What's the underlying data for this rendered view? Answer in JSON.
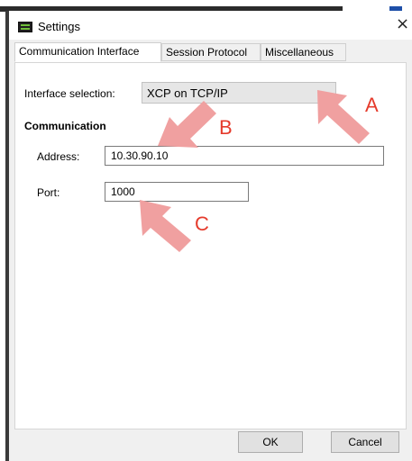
{
  "window": {
    "title": "Settings",
    "close_glyph": "×"
  },
  "tabs": [
    {
      "label": "Communication Interface",
      "active": true
    },
    {
      "label": "Session Protocol",
      "active": false
    },
    {
      "label": "Miscellaneous",
      "active": false
    }
  ],
  "interface": {
    "label": "Interface selection:",
    "value": "XCP on TCP/IP",
    "chevron": "⌄"
  },
  "communication": {
    "heading": "Communication",
    "address_label": "Address:",
    "address_value": "10.30.90.10",
    "port_label": "Port:",
    "port_value": "1000"
  },
  "buttons": {
    "ok": "OK",
    "cancel": "Cancel"
  },
  "annotations": {
    "letters": [
      "A",
      "B",
      "C"
    ],
    "arrow_color": "#f0a0a0",
    "letter_color": "#e53b2c"
  },
  "icons": {
    "app": "settings-app-icon",
    "close": "close-icon",
    "dropdown": "chevron-down-icon"
  }
}
